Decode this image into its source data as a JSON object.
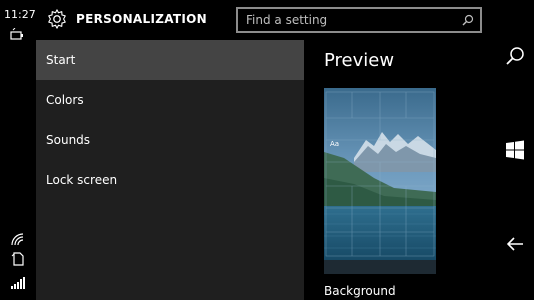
{
  "status": {
    "time": "11:27"
  },
  "header": {
    "title": "PERSONALIZATION",
    "search_placeholder": "Find a setting"
  },
  "nav": {
    "items": [
      {
        "label": "Start",
        "selected": true
      },
      {
        "label": "Colors",
        "selected": false
      },
      {
        "label": "Sounds",
        "selected": false
      },
      {
        "label": "Lock screen",
        "selected": false
      }
    ]
  },
  "preview": {
    "title": "Preview",
    "tile_text": "Aa",
    "background_label": "Background"
  },
  "colors": {
    "nav_background": "#1f1f1f",
    "selected_item": "#444444",
    "page_background": "#000000"
  },
  "icons": {
    "header": "gear-icon",
    "search": "search-icon",
    "right_rail": [
      "search-icon",
      "windows-start-icon",
      "back-arrow-icon"
    ]
  }
}
